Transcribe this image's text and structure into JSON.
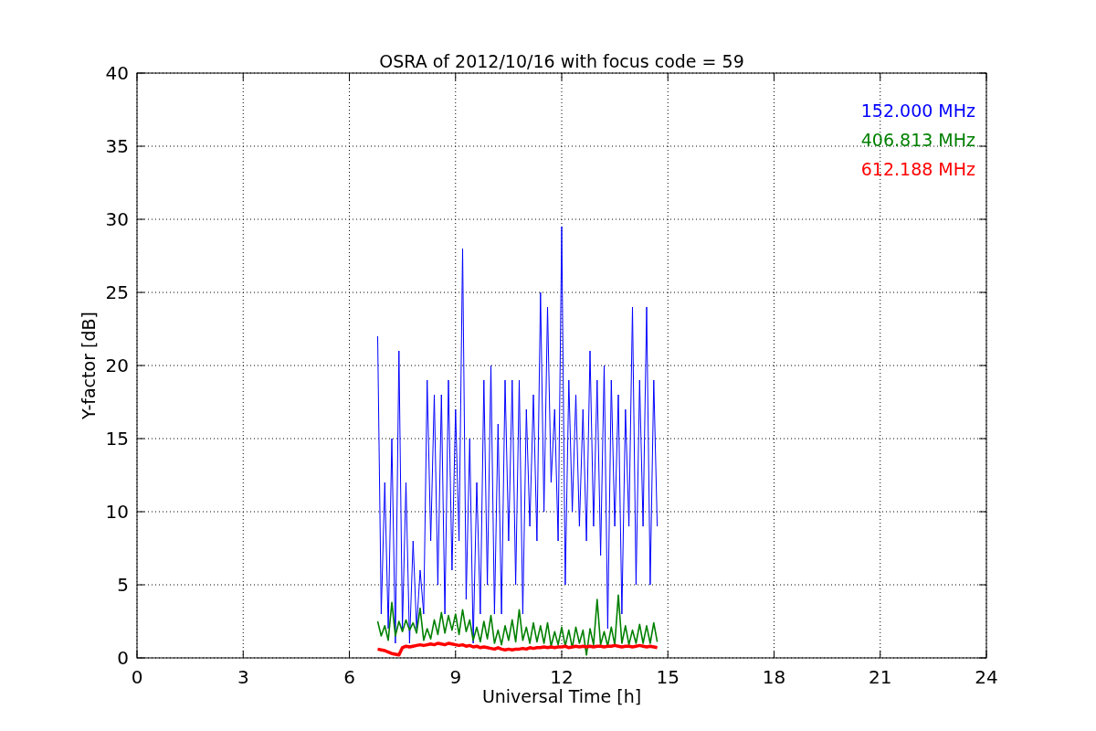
{
  "chart_data": {
    "type": "line",
    "title": "OSRA of 2012/10/16 with focus code = 59",
    "xlabel": "Universal Time [h]",
    "ylabel": "Y-factor [dB]",
    "x": [
      6.8,
      6.9,
      7.0,
      7.1,
      7.2,
      7.3,
      7.4,
      7.5,
      7.6,
      7.7,
      7.8,
      7.9,
      8.0,
      8.1,
      8.2,
      8.3,
      8.4,
      8.5,
      8.6,
      8.7,
      8.8,
      8.9,
      9.0,
      9.1,
      9.2,
      9.3,
      9.4,
      9.5,
      9.6,
      9.7,
      9.8,
      9.9,
      10.0,
      10.1,
      10.2,
      10.3,
      10.4,
      10.5,
      10.6,
      10.7,
      10.8,
      10.9,
      11.0,
      11.1,
      11.2,
      11.3,
      11.4,
      11.5,
      11.6,
      11.7,
      11.8,
      11.9,
      12.0,
      12.1,
      12.2,
      12.3,
      12.4,
      12.5,
      12.6,
      12.7,
      12.8,
      12.9,
      13.0,
      13.1,
      13.2,
      13.3,
      13.4,
      13.5,
      13.6,
      13.7,
      13.8,
      13.9,
      14.0,
      14.1,
      14.2,
      14.3,
      14.4,
      14.5,
      14.6,
      14.7
    ],
    "series": [
      {
        "name": "152.000 MHz",
        "color": "#0000ff",
        "values": [
          22,
          3,
          12,
          2,
          15,
          1,
          21,
          2,
          12,
          1,
          8,
          2,
          6,
          3,
          19,
          8,
          18,
          5,
          18,
          3,
          19,
          6,
          17,
          8,
          28,
          4,
          15,
          1,
          12,
          3,
          19,
          5,
          20,
          3,
          16,
          3,
          19,
          8,
          19,
          5,
          19,
          3,
          17,
          9,
          18,
          8,
          25,
          10,
          24,
          12,
          17,
          8,
          29.5,
          5,
          19,
          10,
          18,
          9,
          17,
          8,
          21,
          9,
          19,
          7,
          20,
          2,
          19,
          9,
          18,
          3,
          17,
          9,
          24,
          5,
          19,
          9,
          24,
          5,
          19,
          9
        ]
      },
      {
        "name": "406.813 MHz",
        "color": "#008000",
        "values": [
          2.5,
          1.5,
          2.2,
          1.2,
          3.8,
          1.5,
          2.5,
          1.8,
          2.6,
          1.9,
          2.4,
          1.7,
          3.4,
          1.2,
          2,
          1.3,
          2.6,
          1.6,
          3.1,
          1.7,
          2.9,
          1.9,
          3,
          1.6,
          3.3,
          1.8,
          2.6,
          1.2,
          2.1,
          1.1,
          2.5,
          1.3,
          2.9,
          1,
          1.9,
          0.9,
          2.2,
          1.2,
          2.6,
          1.1,
          3.3,
          1.2,
          2.1,
          1,
          2.4,
          1.1,
          2.2,
          1,
          2.4,
          0.8,
          1.8,
          0.9,
          2.1,
          0.8,
          1.9,
          0.7,
          2.1,
          1,
          1.9,
          0.2,
          2,
          0.9,
          4,
          0.9,
          1.8,
          0.8,
          2.1,
          0.9,
          4.3,
          1,
          2.2,
          0.9,
          1.9,
          1,
          2.3,
          1,
          2.2,
          1,
          2.4,
          1.1
        ]
      },
      {
        "name": "612.188 MHz",
        "color": "#ff0000",
        "values": [
          0.6,
          0.55,
          0.5,
          0.4,
          0.3,
          0.25,
          0.2,
          0.7,
          0.8,
          0.75,
          0.8,
          0.85,
          0.9,
          0.85,
          0.9,
          0.95,
          0.9,
          1,
          0.95,
          0.9,
          1,
          0.95,
          0.9,
          0.85,
          0.9,
          0.8,
          0.85,
          0.75,
          0.8,
          0.7,
          0.75,
          0.7,
          0.65,
          0.6,
          0.7,
          0.6,
          0.55,
          0.6,
          0.55,
          0.6,
          0.6,
          0.65,
          0.6,
          0.7,
          0.65,
          0.7,
          0.7,
          0.75,
          0.7,
          0.75,
          0.7,
          0.75,
          0.75,
          0.8,
          0.7,
          0.75,
          0.8,
          0.75,
          0.8,
          0.75,
          0.8,
          0.75,
          0.8,
          0.8,
          0.75,
          0.8,
          0.8,
          0.85,
          0.8,
          0.75,
          0.8,
          0.8,
          0.75,
          0.8,
          0.85,
          0.8,
          0.75,
          0.8,
          0.75,
          0.7
        ]
      }
    ],
    "grid": true,
    "xlim": [
      0,
      24
    ],
    "ylim": [
      0,
      40
    ],
    "xticks": [
      0,
      3,
      6,
      9,
      12,
      15,
      18,
      21,
      24
    ],
    "yticks": [
      0,
      5,
      10,
      15,
      20,
      25,
      30,
      35,
      40
    ]
  }
}
